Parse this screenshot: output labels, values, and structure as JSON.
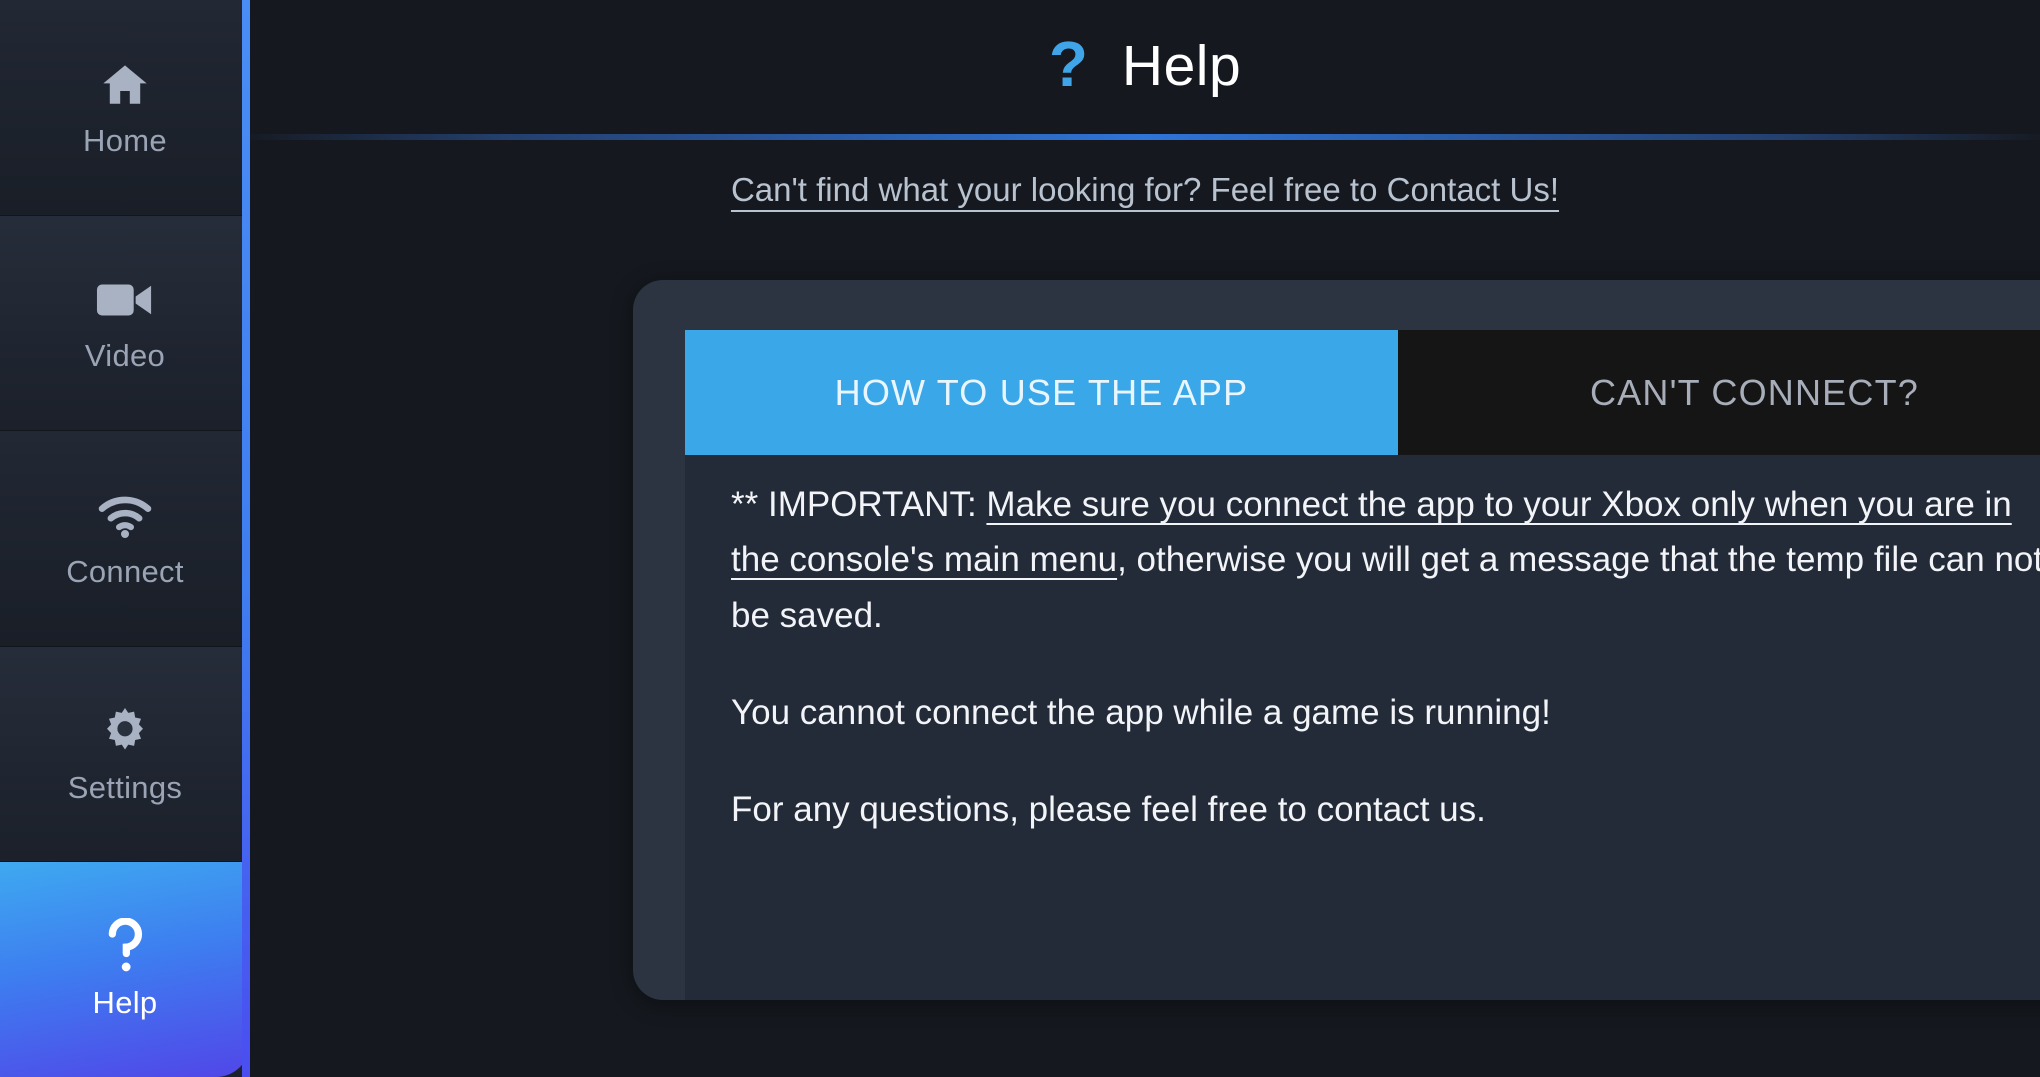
{
  "colors": {
    "accent_blue": "#3aa8e8",
    "sidebar_bg": "#1d222c",
    "card_bg": "#2c3442",
    "content_bg": "#232b38",
    "tab_inactive_bg": "#151515",
    "active_nav_gradient_start": "#3fa9f0",
    "active_nav_gradient_end": "#5146e8",
    "page_bg": "#15191f"
  },
  "sidebar": {
    "items": [
      {
        "label": "Home",
        "icon": "home-icon",
        "active": false
      },
      {
        "label": "Video",
        "icon": "video-icon",
        "active": false
      },
      {
        "label": "Connect",
        "icon": "wifi-icon",
        "active": false
      },
      {
        "label": "Settings",
        "icon": "gear-icon",
        "active": false
      },
      {
        "label": "Help",
        "icon": "question-mark-icon",
        "active": true
      }
    ]
  },
  "header": {
    "icon": "question-mark-icon",
    "icon_glyph": "?",
    "title": "Help"
  },
  "contact": {
    "link_text": "Can't find what your looking for? Feel free to Contact Us!"
  },
  "main": {
    "tabs": [
      {
        "label": "HOW TO USE THE APP",
        "active": true
      },
      {
        "label": "CAN'T CONNECT?",
        "active": false
      }
    ],
    "paragraphs": [
      {
        "segments": [
          {
            "text": "** IMPORTANT: ",
            "underline": false
          },
          {
            "text": "Make sure you connect the app to your Xbox only when you are in the console's main menu",
            "underline": true
          },
          {
            "text": ", otherwise you will get a message that the temp file can not be saved.",
            "underline": false
          }
        ]
      },
      {
        "segments": [
          {
            "text": "You cannot connect the app while a game is running!",
            "underline": false
          }
        ]
      },
      {
        "segments": [
          {
            "text": "For any questions, please feel free to contact us.",
            "underline": false
          }
        ]
      }
    ],
    "scrollbar": {
      "thumb_position_percent": 0,
      "thumb_size_percent": 35
    }
  }
}
